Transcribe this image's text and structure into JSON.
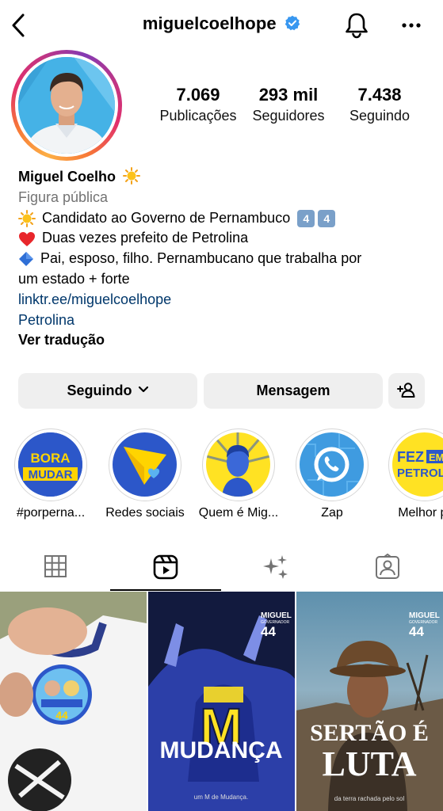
{
  "header": {
    "username": "miguelcoelhope",
    "icons": {
      "back": "chevron-left-icon",
      "verified": "verified-badge-icon",
      "notifications": "bell-icon",
      "more": "more-horizontal-icon"
    },
    "accent_color": "#3897f0"
  },
  "stats": [
    {
      "value": "7.069",
      "label": "Publicações"
    },
    {
      "value": "293 mil",
      "label": "Seguidores"
    },
    {
      "value": "7.438",
      "label": "Seguindo"
    }
  ],
  "bio": {
    "name": "Miguel Coelho",
    "category": "Figura pública",
    "line1": "Candidato ao Governo de Pernambuco",
    "line1_badges": [
      "4",
      "4"
    ],
    "line2": "Duas vezes prefeito de Petrolina",
    "line3a": "Pai, esposo, filho. Pernambucano que trabalha por",
    "line3b": "um estado + forte",
    "link": "linktr.ee/miguelcoelhope",
    "location": "Petrolina",
    "translate": "Ver tradução",
    "link_color": "#00376b"
  },
  "actions": {
    "following": "Seguindo",
    "message": "Mensagem",
    "add_user_icon": "add-user-icon"
  },
  "highlights": [
    {
      "label": "#porperna...",
      "art_text": [
        "BORA",
        "MUDAR"
      ]
    },
    {
      "label": "Redes sociais"
    },
    {
      "label": "Quem é Mig..."
    },
    {
      "label": "Zap"
    },
    {
      "label": "Melhor pr",
      "art_text": [
        "FEZ",
        "EM",
        "PETROLIN"
      ]
    }
  ],
  "tabs": [
    {
      "name": "posts-grid",
      "icon": "grid-icon"
    },
    {
      "name": "reels",
      "icon": "reels-icon",
      "active": true
    },
    {
      "name": "effects",
      "icon": "sparkles-icon"
    },
    {
      "name": "tagged",
      "icon": "tagged-person-icon"
    }
  ],
  "posts": [
    {
      "badge_text": "44"
    },
    {
      "brand": "MIGUEL",
      "brand_sub": "GOVERNADOR",
      "number": "44",
      "headline": "MUDANÇA",
      "big_letter": "M",
      "caption": "um M de Mudança."
    },
    {
      "brand": "MIGUEL",
      "brand_sub": "GOVERNADOR",
      "number": "44",
      "headline_1": "SERTÃO É",
      "headline_2": "LUTA",
      "caption": "da terra rachada pelo sol"
    }
  ]
}
